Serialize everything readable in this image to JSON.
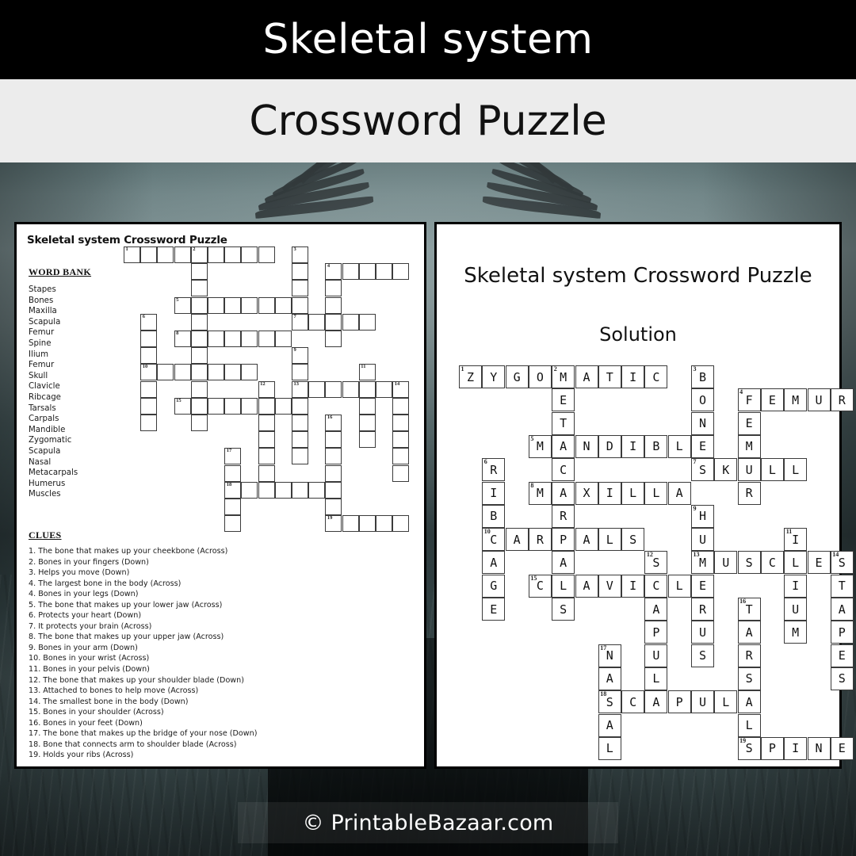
{
  "banner": {
    "title": "Skeletal system",
    "subtitle": "Crossword Puzzle"
  },
  "footer": {
    "watermark": "© PrintableBazaar.com"
  },
  "puzzle_sheet": {
    "heading": "Skeletal system Crossword Puzzle",
    "word_bank_title": "WORD BANK",
    "word_bank": [
      "Stapes",
      "Bones",
      "Maxilla",
      "Scapula",
      "Femur",
      "Spine",
      "Ilium",
      "Femur",
      "Skull",
      "Clavicle",
      "Ribcage",
      "Tarsals",
      "Carpals",
      "Mandible",
      "Zygomatic",
      "Scapula",
      "Nasal",
      "Metacarpals",
      "Humerus",
      "Muscles"
    ],
    "clues_title": "CLUES",
    "clues": [
      "1. The bone that makes up your cheekbone (Across)",
      "2. Bones in your fingers (Down)",
      "3. Helps you move (Down)",
      "4. The largest bone in the body (Across)",
      "4. Bones in your legs (Down)",
      "5. The bone that makes up your lower jaw (Across)",
      "6. Protects your heart (Down)",
      "7. It protects your brain (Across)",
      "8. The bone that makes up your upper jaw (Across)",
      "9. Bones in your arm (Down)",
      "10. Bones in your wrist (Across)",
      "11. Bones in your pelvis (Down)",
      "12. The bone that makes up your shoulder blade (Down)",
      "13. Attached to bones to help move (Across)",
      "14. The smallest bone in the body (Down)",
      "15. Bones in your shoulder (Across)",
      "16. Bones in your feet (Down)",
      "17. The bone that makes up the bridge of your nose (Down)",
      "18. Bone that connects arm to shoulder blade (Across)",
      "19. Holds your ribs (Across)"
    ]
  },
  "solution_sheet": {
    "heading": "Skeletal system Crossword Puzzle",
    "label": "Solution"
  },
  "crossword": {
    "columns": 16,
    "rows": 15,
    "answers": {
      "1-across": "ZYGOMATIC",
      "4-across": "FEMUR",
      "5-across": "MANDIBLE",
      "7-across": "SKULL",
      "8-across": "MAXILLA",
      "10-across": "CARPALS",
      "13-across": "MUSCLES",
      "15-across": "CLAVICLE",
      "18-across": "SCAPULA",
      "19-across": "SPINE",
      "2-down": "METACARPALS",
      "3-down": "BONES",
      "4-down": "FEMUR",
      "6-down": "RIBCAGE",
      "9-down": "HUMERUS",
      "11-down": "ILIUM",
      "12-down": "SCAPULA",
      "14-down": "STAPES",
      "16-down": "TARSALS",
      "17-down": "NASAL"
    },
    "cells": [
      {
        "r": 0,
        "c": 0,
        "l": "Z",
        "n": "1"
      },
      {
        "r": 0,
        "c": 1,
        "l": "Y"
      },
      {
        "r": 0,
        "c": 2,
        "l": "G"
      },
      {
        "r": 0,
        "c": 3,
        "l": "O"
      },
      {
        "r": 0,
        "c": 4,
        "l": "M",
        "n": "2"
      },
      {
        "r": 0,
        "c": 5,
        "l": "A"
      },
      {
        "r": 0,
        "c": 6,
        "l": "T"
      },
      {
        "r": 0,
        "c": 7,
        "l": "I"
      },
      {
        "r": 0,
        "c": 8,
        "l": "C"
      },
      {
        "r": 0,
        "c": 10,
        "l": "B",
        "n": "3"
      },
      {
        "r": 1,
        "c": 4,
        "l": "E"
      },
      {
        "r": 1,
        "c": 10,
        "l": "O"
      },
      {
        "r": 1,
        "c": 12,
        "l": "F",
        "n": "4"
      },
      {
        "r": 1,
        "c": 13,
        "l": "E"
      },
      {
        "r": 1,
        "c": 14,
        "l": "M"
      },
      {
        "r": 1,
        "c": 15,
        "l": "U"
      },
      {
        "r": 1,
        "c": 16,
        "l": "R"
      },
      {
        "r": 2,
        "c": 4,
        "l": "T"
      },
      {
        "r": 2,
        "c": 10,
        "l": "N"
      },
      {
        "r": 2,
        "c": 12,
        "l": "E"
      },
      {
        "r": 3,
        "c": 3,
        "l": "M",
        "n": "5"
      },
      {
        "r": 3,
        "c": 4,
        "l": "A"
      },
      {
        "r": 3,
        "c": 5,
        "l": "N"
      },
      {
        "r": 3,
        "c": 6,
        "l": "D"
      },
      {
        "r": 3,
        "c": 7,
        "l": "I"
      },
      {
        "r": 3,
        "c": 8,
        "l": "B"
      },
      {
        "r": 3,
        "c": 9,
        "l": "L"
      },
      {
        "r": 3,
        "c": 10,
        "l": "E"
      },
      {
        "r": 3,
        "c": 12,
        "l": "M"
      },
      {
        "r": 4,
        "c": 1,
        "l": "R",
        "n": "6"
      },
      {
        "r": 4,
        "c": 4,
        "l": "C"
      },
      {
        "r": 4,
        "c": 10,
        "l": "S",
        "n": "7"
      },
      {
        "r": 4,
        "c": 11,
        "l": "K"
      },
      {
        "r": 4,
        "c": 12,
        "l": "U"
      },
      {
        "r": 4,
        "c": 13,
        "l": "L"
      },
      {
        "r": 4,
        "c": 14,
        "l": "L"
      },
      {
        "r": 5,
        "c": 1,
        "l": "I"
      },
      {
        "r": 5,
        "c": 3,
        "l": "M",
        "n": "8"
      },
      {
        "r": 5,
        "c": 4,
        "l": "A"
      },
      {
        "r": 5,
        "c": 5,
        "l": "X"
      },
      {
        "r": 5,
        "c": 6,
        "l": "I"
      },
      {
        "r": 5,
        "c": 7,
        "l": "L"
      },
      {
        "r": 5,
        "c": 8,
        "l": "L"
      },
      {
        "r": 5,
        "c": 9,
        "l": "A"
      },
      {
        "r": 5,
        "c": 12,
        "l": "R"
      },
      {
        "r": 6,
        "c": 1,
        "l": "B"
      },
      {
        "r": 6,
        "c": 4,
        "l": "R"
      },
      {
        "r": 6,
        "c": 10,
        "l": "H",
        "n": "9"
      },
      {
        "r": 7,
        "c": 1,
        "l": "C",
        "n": "10"
      },
      {
        "r": 7,
        "c": 2,
        "l": "A"
      },
      {
        "r": 7,
        "c": 3,
        "l": "R"
      },
      {
        "r": 7,
        "c": 4,
        "l": "P"
      },
      {
        "r": 7,
        "c": 5,
        "l": "A"
      },
      {
        "r": 7,
        "c": 6,
        "l": "L"
      },
      {
        "r": 7,
        "c": 7,
        "l": "S"
      },
      {
        "r": 7,
        "c": 10,
        "l": "U"
      },
      {
        "r": 7,
        "c": 14,
        "l": "I",
        "n": "11"
      },
      {
        "r": 8,
        "c": 1,
        "l": "A"
      },
      {
        "r": 8,
        "c": 4,
        "l": "A"
      },
      {
        "r": 8,
        "c": 8,
        "l": "S",
        "n": "12"
      },
      {
        "r": 8,
        "c": 10,
        "l": "M",
        "n": "13"
      },
      {
        "r": 8,
        "c": 11,
        "l": "U"
      },
      {
        "r": 8,
        "c": 12,
        "l": "S"
      },
      {
        "r": 8,
        "c": 13,
        "l": "C"
      },
      {
        "r": 8,
        "c": 14,
        "l": "L"
      },
      {
        "r": 8,
        "c": 15,
        "l": "E"
      },
      {
        "r": 8,
        "c": 16,
        "l": "S",
        "n": "14"
      },
      {
        "r": 9,
        "c": 1,
        "l": "G"
      },
      {
        "r": 9,
        "c": 3,
        "l": "C",
        "n": "15"
      },
      {
        "r": 9,
        "c": 4,
        "l": "L"
      },
      {
        "r": 9,
        "c": 5,
        "l": "A"
      },
      {
        "r": 9,
        "c": 6,
        "l": "V"
      },
      {
        "r": 9,
        "c": 7,
        "l": "I"
      },
      {
        "r": 9,
        "c": 8,
        "l": "C"
      },
      {
        "r": 9,
        "c": 9,
        "l": "L"
      },
      {
        "r": 9,
        "c": 10,
        "l": "E"
      },
      {
        "r": 9,
        "c": 14,
        "l": "I"
      },
      {
        "r": 9,
        "c": 16,
        "l": "T"
      },
      {
        "r": 10,
        "c": 1,
        "l": "E"
      },
      {
        "r": 10,
        "c": 4,
        "l": "S"
      },
      {
        "r": 10,
        "c": 8,
        "l": "A"
      },
      {
        "r": 10,
        "c": 10,
        "l": "R"
      },
      {
        "r": 10,
        "c": 12,
        "l": "T",
        "n": "16"
      },
      {
        "r": 10,
        "c": 14,
        "l": "U"
      },
      {
        "r": 10,
        "c": 16,
        "l": "A"
      },
      {
        "r": 11,
        "c": 8,
        "l": "P"
      },
      {
        "r": 11,
        "c": 10,
        "l": "U"
      },
      {
        "r": 11,
        "c": 12,
        "l": "A"
      },
      {
        "r": 11,
        "c": 14,
        "l": "M"
      },
      {
        "r": 11,
        "c": 16,
        "l": "P"
      },
      {
        "r": 12,
        "c": 6,
        "l": "N",
        "n": "17"
      },
      {
        "r": 12,
        "c": 8,
        "l": "U"
      },
      {
        "r": 12,
        "c": 10,
        "l": "S"
      },
      {
        "r": 12,
        "c": 12,
        "l": "R"
      },
      {
        "r": 12,
        "c": 16,
        "l": "E"
      },
      {
        "r": 13,
        "c": 6,
        "l": "A"
      },
      {
        "r": 13,
        "c": 8,
        "l": "L"
      },
      {
        "r": 13,
        "c": 12,
        "l": "S"
      },
      {
        "r": 13,
        "c": 16,
        "l": "S"
      },
      {
        "r": 14,
        "c": 6,
        "l": "S",
        "n": "18"
      },
      {
        "r": 14,
        "c": 7,
        "l": "C"
      },
      {
        "r": 14,
        "c": 8,
        "l": "A"
      },
      {
        "r": 14,
        "c": 9,
        "l": "P"
      },
      {
        "r": 14,
        "c": 10,
        "l": "U"
      },
      {
        "r": 14,
        "c": 11,
        "l": "L"
      },
      {
        "r": 14,
        "c": 12,
        "l": "A"
      },
      {
        "r": 15,
        "c": 6,
        "l": "A"
      },
      {
        "r": 15,
        "c": 12,
        "l": "L"
      },
      {
        "r": 16,
        "c": 6,
        "l": "L"
      },
      {
        "r": 16,
        "c": 12,
        "l": "S",
        "n": "19"
      },
      {
        "r": 16,
        "c": 13,
        "l": "P"
      },
      {
        "r": 16,
        "c": 14,
        "l": "I"
      },
      {
        "r": 16,
        "c": 15,
        "l": "N"
      },
      {
        "r": 16,
        "c": 16,
        "l": "E"
      }
    ]
  }
}
